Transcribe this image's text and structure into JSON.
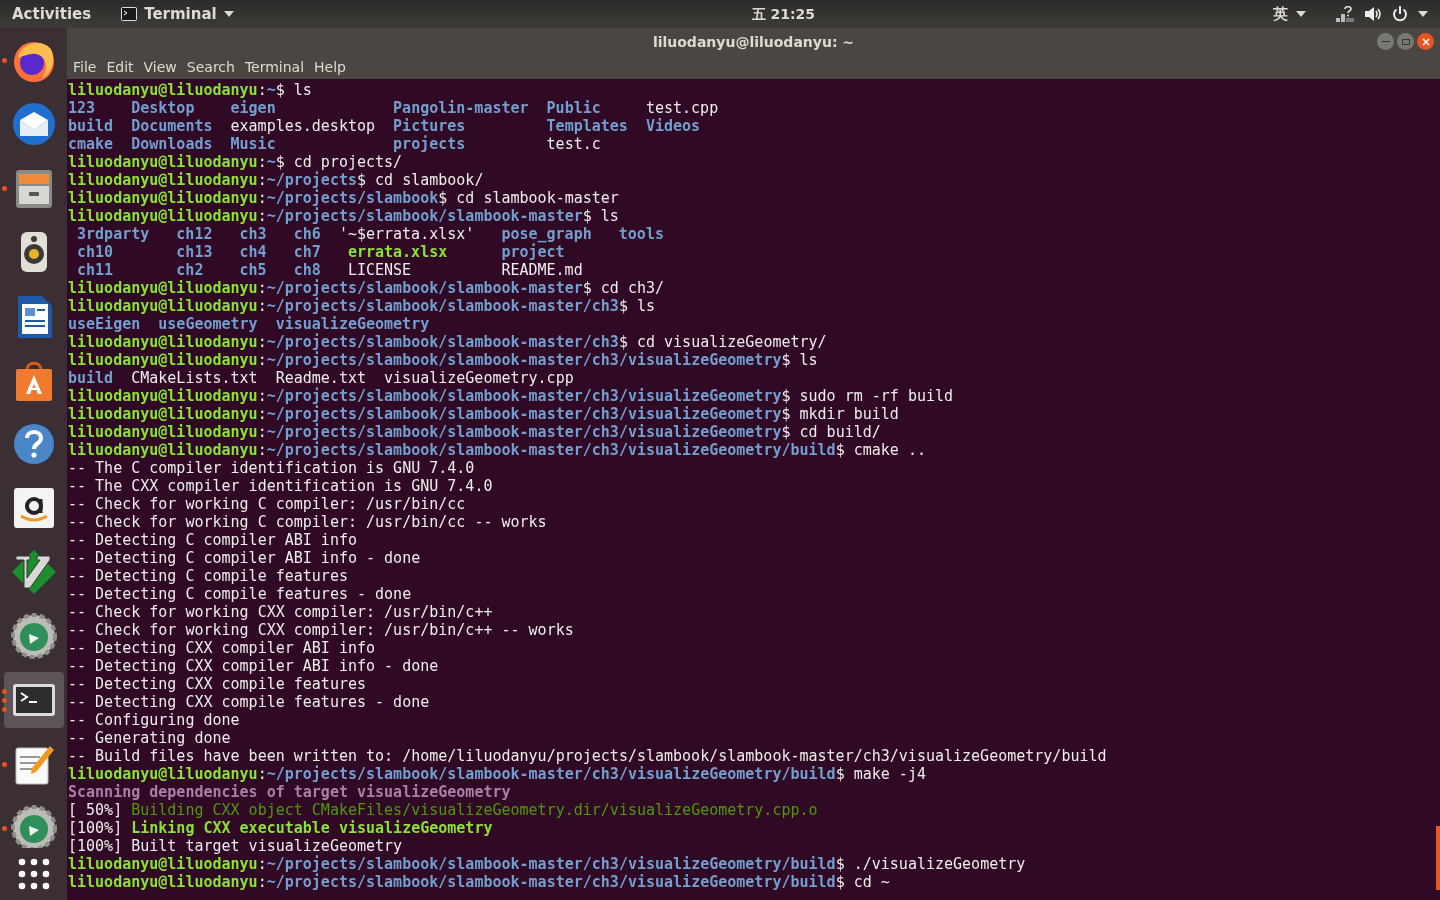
{
  "top_bar": {
    "activities": "Activities",
    "app_menu": "Terminal",
    "clock": "五 21:25",
    "input_method": "英"
  },
  "dock": {
    "items": [
      {
        "kind": "firefox",
        "running": true,
        "multiple": false,
        "selected": false
      },
      {
        "kind": "mail",
        "running": false,
        "multiple": false,
        "selected": false
      },
      {
        "kind": "files",
        "running": true,
        "multiple": false,
        "selected": false
      },
      {
        "kind": "speaker",
        "running": false,
        "multiple": false,
        "selected": false
      },
      {
        "kind": "document",
        "running": false,
        "multiple": false,
        "selected": false
      },
      {
        "kind": "store",
        "running": false,
        "multiple": false,
        "selected": false
      },
      {
        "kind": "help",
        "running": false,
        "multiple": false,
        "selected": false
      },
      {
        "kind": "amazon",
        "running": false,
        "multiple": false,
        "selected": false
      },
      {
        "kind": "vim",
        "running": false,
        "multiple": false,
        "selected": false
      },
      {
        "kind": "gear",
        "running": false,
        "multiple": false,
        "selected": false
      },
      {
        "kind": "terminal",
        "running": true,
        "multiple": true,
        "selected": true
      },
      {
        "kind": "notepad",
        "running": true,
        "multiple": false,
        "selected": false
      },
      {
        "kind": "gear",
        "running": true,
        "multiple": false,
        "selected": false
      }
    ]
  },
  "window": {
    "title": "liluodanyu@liluodanyu: ~",
    "menu": [
      "File",
      "Edit",
      "View",
      "Search",
      "Terminal",
      "Help"
    ]
  },
  "terminal": {
    "separator": ":",
    "prompt_symbol": "$",
    "lines": [
      {
        "kind": "prompt",
        "user": "liluodanyu@liluodanyu",
        "path": "~",
        "command": "ls"
      },
      {
        "kind": "listing",
        "rows": [
          [
            {
              "name": "123",
              "kind": "dir"
            },
            {
              "name": "Desktop",
              "kind": "dir"
            },
            {
              "name": "eigen",
              "kind": "dir"
            },
            {
              "name": "Pangolin-master",
              "kind": "dir"
            },
            {
              "name": "Public",
              "kind": "dir"
            },
            {
              "name": "test.cpp",
              "kind": "file"
            }
          ],
          [
            {
              "name": "build",
              "kind": "dir"
            },
            {
              "name": "Documents",
              "kind": "dir"
            },
            {
              "name": "examples.desktop",
              "kind": "file"
            },
            {
              "name": "Pictures",
              "kind": "dir"
            },
            {
              "name": "Templates",
              "kind": "dir"
            },
            {
              "name": "Videos",
              "kind": "dir"
            }
          ],
          [
            {
              "name": "cmake",
              "kind": "dir"
            },
            {
              "name": "Downloads",
              "kind": "dir"
            },
            {
              "name": "Music",
              "kind": "dir"
            },
            {
              "name": "projects",
              "kind": "dir"
            },
            {
              "name": "test.c",
              "kind": "file"
            }
          ]
        ]
      },
      {
        "kind": "prompt",
        "user": "liluodanyu@liluodanyu",
        "path": "~",
        "command": "cd projects/"
      },
      {
        "kind": "prompt",
        "user": "liluodanyu@liluodanyu",
        "path": "~/projects",
        "command": "cd slambook/"
      },
      {
        "kind": "prompt",
        "user": "liluodanyu@liluodanyu",
        "path": "~/projects/slambook",
        "command": "cd slambook-master"
      },
      {
        "kind": "prompt",
        "user": "liluodanyu@liluodanyu",
        "path": "~/projects/slambook/slambook-master",
        "command": "ls"
      },
      {
        "kind": "listing",
        "rows": [
          [
            {
              "name": "3rdparty",
              "kind": "dir"
            },
            {
              "name": "ch12",
              "kind": "dir"
            },
            {
              "name": "ch3",
              "kind": "dir"
            },
            {
              "name": "ch6",
              "kind": "dir"
            },
            {
              "name": "'~$errata.xlsx'",
              "kind": "quoted"
            },
            {
              "name": "pose_graph",
              "kind": "dir"
            },
            {
              "name": "tools",
              "kind": "dir"
            }
          ],
          [
            {
              "name": "ch10",
              "kind": "dir"
            },
            {
              "name": "ch13",
              "kind": "dir"
            },
            {
              "name": "ch4",
              "kind": "dir"
            },
            {
              "name": "ch7",
              "kind": "dir"
            },
            {
              "name": "errata.xlsx",
              "kind": "exec"
            },
            {
              "name": "project",
              "kind": "dir"
            }
          ],
          [
            {
              "name": "ch11",
              "kind": "dir"
            },
            {
              "name": "ch2",
              "kind": "dir"
            },
            {
              "name": "ch5",
              "kind": "dir"
            },
            {
              "name": "ch8",
              "kind": "dir"
            },
            {
              "name": "LICENSE",
              "kind": "file"
            },
            {
              "name": "README.md",
              "kind": "file"
            }
          ]
        ]
      },
      {
        "kind": "prompt",
        "user": "liluodanyu@liluodanyu",
        "path": "~/projects/slambook/slambook-master",
        "command": "cd ch3/"
      },
      {
        "kind": "prompt",
        "user": "liluodanyu@liluodanyu",
        "path": "~/projects/slambook/slambook-master/ch3",
        "command": "ls"
      },
      {
        "kind": "listing",
        "rows": [
          [
            {
              "name": "useEigen",
              "kind": "dir"
            },
            {
              "name": "useGeometry",
              "kind": "dir"
            },
            {
              "name": "visualizeGeometry",
              "kind": "dir"
            }
          ]
        ]
      },
      {
        "kind": "prompt",
        "user": "liluodanyu@liluodanyu",
        "path": "~/projects/slambook/slambook-master/ch3",
        "command": "cd visualizeGeometry/"
      },
      {
        "kind": "prompt",
        "user": "liluodanyu@liluodanyu",
        "path": "~/projects/slambook/slambook-master/ch3/visualizeGeometry",
        "command": "ls"
      },
      {
        "kind": "listing",
        "rows": [
          [
            {
              "name": "build",
              "kind": "dir"
            },
            {
              "name": "CMakeLists.txt",
              "kind": "file"
            },
            {
              "name": "Readme.txt",
              "kind": "file"
            },
            {
              "name": "visualizeGeometry.cpp",
              "kind": "file"
            }
          ]
        ]
      },
      {
        "kind": "prompt",
        "user": "liluodanyu@liluodanyu",
        "path": "~/projects/slambook/slambook-master/ch3/visualizeGeometry",
        "command": "sudo rm -rf build"
      },
      {
        "kind": "prompt",
        "user": "liluodanyu@liluodanyu",
        "path": "~/projects/slambook/slambook-master/ch3/visualizeGeometry",
        "command": "mkdir build"
      },
      {
        "kind": "prompt",
        "user": "liluodanyu@liluodanyu",
        "path": "~/projects/slambook/slambook-master/ch3/visualizeGeometry",
        "command": "cd build/"
      },
      {
        "kind": "prompt",
        "user": "liluodanyu@liluodanyu",
        "path": "~/projects/slambook/slambook-master/ch3/visualizeGeometry/build",
        "command": "cmake .."
      },
      {
        "kind": "output",
        "text": "-- The C compiler identification is GNU 7.4.0"
      },
      {
        "kind": "output",
        "text": "-- The CXX compiler identification is GNU 7.4.0"
      },
      {
        "kind": "output",
        "text": "-- Check for working C compiler: /usr/bin/cc"
      },
      {
        "kind": "output",
        "text": "-- Check for working C compiler: /usr/bin/cc -- works"
      },
      {
        "kind": "output",
        "text": "-- Detecting C compiler ABI info"
      },
      {
        "kind": "output",
        "text": "-- Detecting C compiler ABI info - done"
      },
      {
        "kind": "output",
        "text": "-- Detecting C compile features"
      },
      {
        "kind": "output",
        "text": "-- Detecting C compile features - done"
      },
      {
        "kind": "output",
        "text": "-- Check for working CXX compiler: /usr/bin/c++"
      },
      {
        "kind": "output",
        "text": "-- Check for working CXX compiler: /usr/bin/c++ -- works"
      },
      {
        "kind": "output",
        "text": "-- Detecting CXX compiler ABI info"
      },
      {
        "kind": "output",
        "text": "-- Detecting CXX compiler ABI info - done"
      },
      {
        "kind": "output",
        "text": "-- Detecting CXX compile features"
      },
      {
        "kind": "output",
        "text": "-- Detecting CXX compile features - done"
      },
      {
        "kind": "output",
        "text": "-- Configuring done"
      },
      {
        "kind": "output",
        "text": "-- Generating done"
      },
      {
        "kind": "output",
        "text": "-- Build files have been written to: /home/liluodanyu/projects/slambook/slambook-master/ch3/visualizeGeometry/build"
      },
      {
        "kind": "prompt",
        "user": "liluodanyu@liluodanyu",
        "path": "~/projects/slambook/slambook-master/ch3/visualizeGeometry/build",
        "command": "make -j4"
      },
      {
        "kind": "scan",
        "text": "Scanning dependencies of target visualizeGeometry"
      },
      {
        "kind": "make_build",
        "progress": "[ 50%]",
        "text": "Building CXX object CMakeFiles/visualizeGeometry.dir/visualizeGeometry.cpp.o"
      },
      {
        "kind": "make_link",
        "progress": "[100%]",
        "text": "Linking CXX executable visualizeGeometry"
      },
      {
        "kind": "make_done",
        "progress": "[100%]",
        "text": "Built target visualizeGeometry"
      },
      {
        "kind": "prompt",
        "user": "liluodanyu@liluodanyu",
        "path": "~/projects/slambook/slambook-master/ch3/visualizeGeometry/build",
        "command": "./visualizeGeometry"
      },
      {
        "kind": "prompt",
        "user": "liluodanyu@liluodanyu",
        "path": "~/projects/slambook/slambook-master/ch3/visualizeGeometry/build",
        "command": "cd ~"
      }
    ]
  }
}
